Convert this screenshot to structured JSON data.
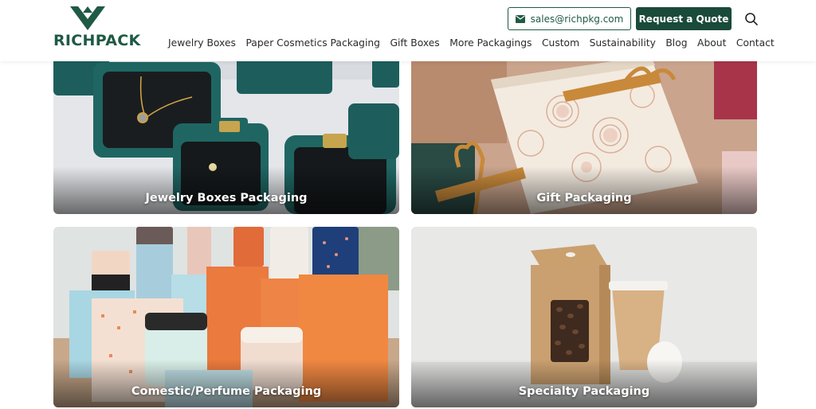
{
  "header": {
    "logo_text": "RICHPACK",
    "email": "sales@richpkg.com",
    "quote_label": "Request a Quote",
    "icons": {
      "mail": "mail-icon",
      "search": "search-icon"
    },
    "colors": {
      "brand": "#1f5a44",
      "brand_dark": "#1a4a3a"
    }
  },
  "nav": {
    "items": [
      {
        "label": "Jewelry Boxes"
      },
      {
        "label": "Paper Cosmetics Packaging"
      },
      {
        "label": "Gift Boxes"
      },
      {
        "label": "More Packagings"
      },
      {
        "label": "Custom"
      },
      {
        "label": "Sustainability"
      },
      {
        "label": "Blog"
      },
      {
        "label": "About"
      },
      {
        "label": "Contact"
      }
    ]
  },
  "categories": [
    {
      "title": "Jewelry Boxes Packaging"
    },
    {
      "title": "Gift Packaging"
    },
    {
      "title": "Comestic/Perfume Packaging"
    },
    {
      "title": "Specialty Packaging"
    }
  ]
}
